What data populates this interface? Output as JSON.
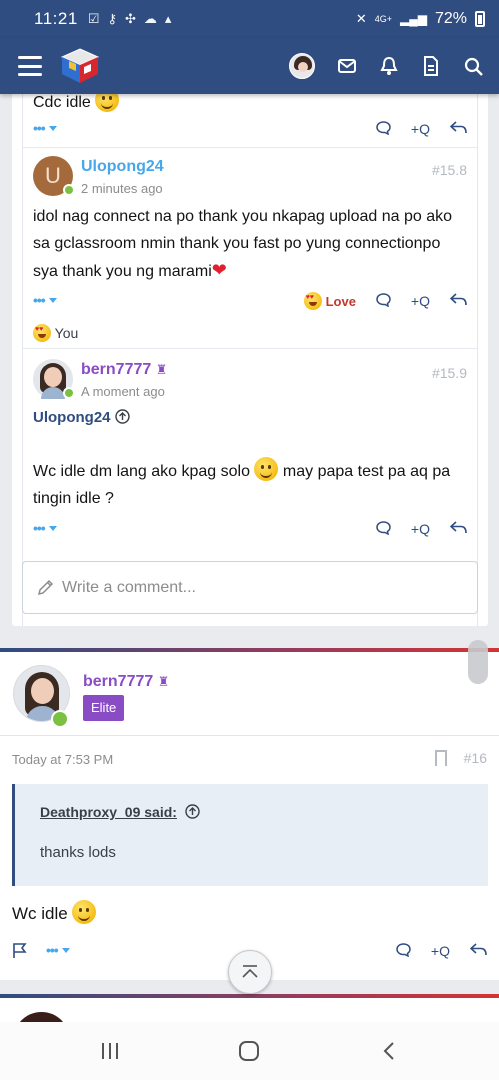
{
  "status_bar": {
    "time": "11:21",
    "battery": "72%",
    "network": "4G+"
  },
  "colors": {
    "header": "#2f4d80",
    "link": "#47a7eb",
    "staff": "#8a4cc5",
    "online": "#7ac143",
    "love": "#c0392b"
  },
  "comments": [
    {
      "text": "Cdc idle",
      "emoji": "slight-smile"
    },
    {
      "avatar_letter": "U",
      "username": "Ulopong24",
      "time": "2 minutes ago",
      "number": "#15.8",
      "text": "idol nag connect na po thank you nkapag upload na po ako sa gclassroom nmin thank you fast po yung connectionpo sya thank you ng marami",
      "reaction_label": "Love",
      "reactions_by": "You"
    },
    {
      "username": "bern7777",
      "time": "A moment ago",
      "number": "#15.9",
      "mention": "Ulopong24",
      "text_part1": "Wc idle dm lang ako kpag solo",
      "text_part2": "may papa test pa aq pa tingin idle ?"
    }
  ],
  "actions": {
    "quote_label": "+Q",
    "more_label": "•••"
  },
  "write_comment": {
    "placeholder": "Write a comment..."
  },
  "post": {
    "username": "bern7777",
    "role": "Elite",
    "date": "Today at 7:53 PM",
    "number": "#16",
    "quote_author": "Deathproxy_09 said:",
    "quote_text": "thanks lods",
    "body": "Wc idle"
  }
}
